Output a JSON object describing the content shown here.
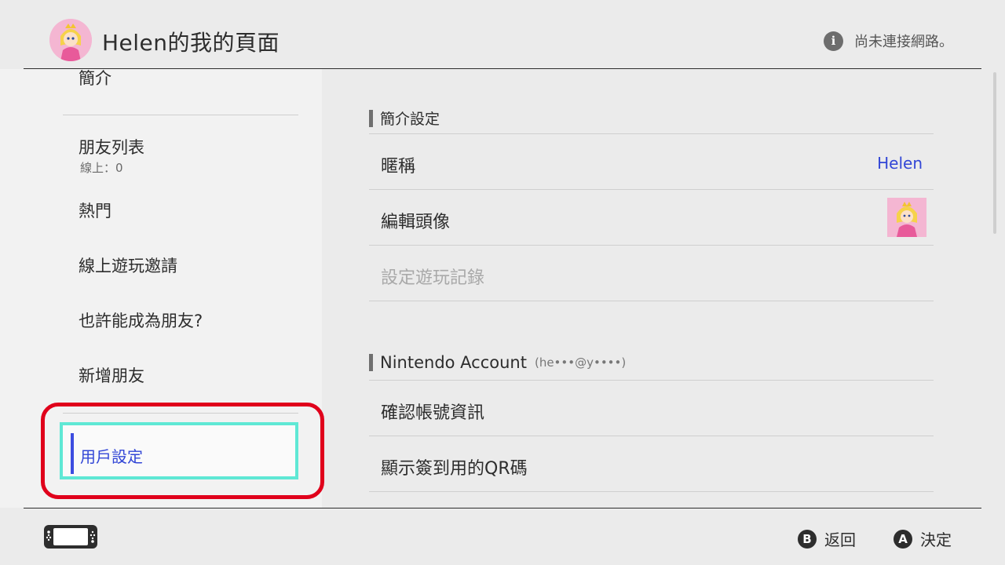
{
  "header": {
    "title": "Helen的我的頁面",
    "network_status": "尚未連接網路。",
    "info_icon": "i"
  },
  "sidebar": {
    "items": [
      {
        "label": "簡介"
      },
      {
        "label": "朋友列表",
        "sub": "線上：0"
      },
      {
        "label": "熱門"
      },
      {
        "label": "線上遊玩邀請"
      },
      {
        "label": "也許能成為朋友?"
      },
      {
        "label": "新增朋友"
      },
      {
        "label": "用戶設定",
        "selected": true
      }
    ]
  },
  "main": {
    "profile_section": {
      "title": "簡介設定",
      "rows": [
        {
          "label": "暱稱",
          "value": "Helen"
        },
        {
          "label": "編輯頭像"
        },
        {
          "label": "設定遊玩記錄",
          "disabled": true
        }
      ]
    },
    "account_section": {
      "title": "Nintendo Account",
      "email": "(he•••@y••••)",
      "rows": [
        {
          "label": "確認帳號資訊"
        },
        {
          "label": "顯示簽到用的QR碼"
        }
      ]
    }
  },
  "footer": {
    "back": {
      "button": "B",
      "label": "返回"
    },
    "confirm": {
      "button": "A",
      "label": "決定"
    }
  },
  "colors": {
    "accent": "#3246d6",
    "selection_border": "#5fe8d5",
    "highlight_ring": "#e0001b",
    "background": "#ebebeb"
  },
  "icons": [
    "avatar-peach",
    "info-icon",
    "switch-console-icon",
    "b-button-icon",
    "a-button-icon"
  ]
}
